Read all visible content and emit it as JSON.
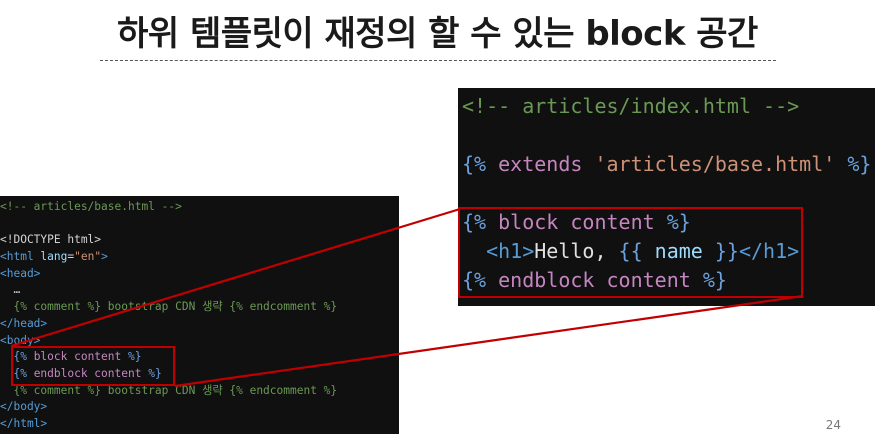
{
  "slide": {
    "title": "하위 템플릿이 재정의 할 수 있는 block 공간",
    "page_number": "24"
  },
  "base_code": {
    "lines": [
      [
        {
          "t": "<!-- articles/base.html -->",
          "c": "c-com"
        }
      ],
      [],
      [
        {
          "t": "<!DOCTYPE html>",
          "c": "c-txt"
        }
      ],
      [
        {
          "t": "<html ",
          "c": "c-tag"
        },
        {
          "t": "lang",
          "c": "c-attr"
        },
        {
          "t": "=",
          "c": "c-txt"
        },
        {
          "t": "\"en\"",
          "c": "c-str"
        },
        {
          "t": ">",
          "c": "c-tag"
        }
      ],
      [
        {
          "t": "<head>",
          "c": "c-tag"
        }
      ],
      [
        {
          "t": "  …",
          "c": "c-txt"
        }
      ],
      [
        {
          "t": "  {% comment %} bootstrap CDN 생략 {% endcomment %}",
          "c": "c-com"
        }
      ],
      [
        {
          "t": "</head>",
          "c": "c-tag"
        }
      ],
      [
        {
          "t": "<body>",
          "c": "c-tag"
        }
      ],
      [
        {
          "t": "  {% ",
          "c": "c-dj"
        },
        {
          "t": "block content",
          "c": "c-kw"
        },
        {
          "t": " %}",
          "c": "c-dj"
        }
      ],
      [
        {
          "t": "  {% ",
          "c": "c-dj"
        },
        {
          "t": "endblock content",
          "c": "c-kw"
        },
        {
          "t": " %}",
          "c": "c-dj"
        }
      ],
      [
        {
          "t": "  {% comment %} bootstrap CDN 생략 {% endcomment %}",
          "c": "c-com"
        }
      ],
      [
        {
          "t": "</body>",
          "c": "c-tag"
        }
      ],
      [
        {
          "t": "</html>",
          "c": "c-tag"
        }
      ]
    ]
  },
  "index_code": {
    "lines": [
      [
        {
          "t": "<!-- articles/index.html -->",
          "c": "c-com"
        }
      ],
      [],
      [
        {
          "t": "{% ",
          "c": "c-dj"
        },
        {
          "t": "extends ",
          "c": "c-kw"
        },
        {
          "t": "'articles/base.html'",
          "c": "c-str"
        },
        {
          "t": " %}",
          "c": "c-dj"
        }
      ],
      [],
      [
        {
          "t": "{% ",
          "c": "c-dj"
        },
        {
          "t": "block content",
          "c": "c-kw"
        },
        {
          "t": " %}",
          "c": "c-dj"
        }
      ],
      [
        {
          "t": "  <h1>",
          "c": "c-tag"
        },
        {
          "t": "Hello, ",
          "c": "c-plain"
        },
        {
          "t": "{{ ",
          "c": "c-dj"
        },
        {
          "t": "name",
          "c": "c-attr"
        },
        {
          "t": " }}",
          "c": "c-dj"
        },
        {
          "t": "</h1>",
          "c": "c-tag"
        }
      ],
      [
        {
          "t": "{% ",
          "c": "c-dj"
        },
        {
          "t": "endblock content",
          "c": "c-kw"
        },
        {
          "t": " %}",
          "c": "c-dj"
        }
      ]
    ]
  },
  "colors": {
    "highlight": "#c00000",
    "code_bg": "#101010"
  }
}
